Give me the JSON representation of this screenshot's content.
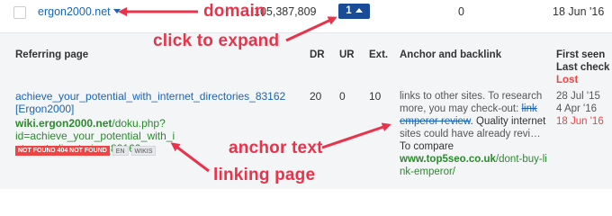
{
  "row": {
    "domain": "ergon2000.net",
    "referring_count": "105,387,809",
    "expand_count": "1",
    "zero": "0",
    "date": "18 Jun '16"
  },
  "annotations": {
    "domain": "domain",
    "click_to_expand": "click to expand",
    "anchor_text": "anchor text",
    "linking_page": "linking page"
  },
  "table": {
    "headers": {
      "referring_page": "Referring page",
      "dr": "DR",
      "ur": "UR",
      "ext": "Ext.",
      "anchor": "Anchor and backlink",
      "first_seen": "First seen",
      "last_check": "Last check",
      "lost": "Lost"
    },
    "rows": [
      {
        "title_line1": "achieve_your_potential_with_internet_directories_83162",
        "title_line2": "[Ergon2000]",
        "url_domain": "wiki.ergon2000.net",
        "url_path1": "/doku.php?id=achieve_your_potential_with_i",
        "url_path2": "nternet_directories_83162",
        "tags": [
          "NOT FOUND 404 NOT FOUND",
          "EN",
          "WIKIS"
        ],
        "dr": "20",
        "ur": "0",
        "ext": "10",
        "anchor_line1": "links to other sites. To research",
        "anchor_line2": "more, you may check-out: ",
        "anchor_strike1": "link",
        "anchor_strike2": "emperor review",
        "anchor_line3_rest": ". Quality internet",
        "anchor_line4": "sites could have already revi…",
        "anchor_line5": "To compare",
        "backlink_domain": "www.top5seo.co.uk",
        "backlink_path1": "/dont-buy-li",
        "backlink_path2": "nk-emperor/",
        "first_seen": "28 Jul '15",
        "last_check": "4 Apr '16",
        "lost": "18 Jun '16"
      }
    ]
  },
  "colors": {
    "annotation": "#e8334b",
    "link_blue": "#1a64b4",
    "url_green": "#2c8a2c",
    "badge": "#1a4b99"
  }
}
